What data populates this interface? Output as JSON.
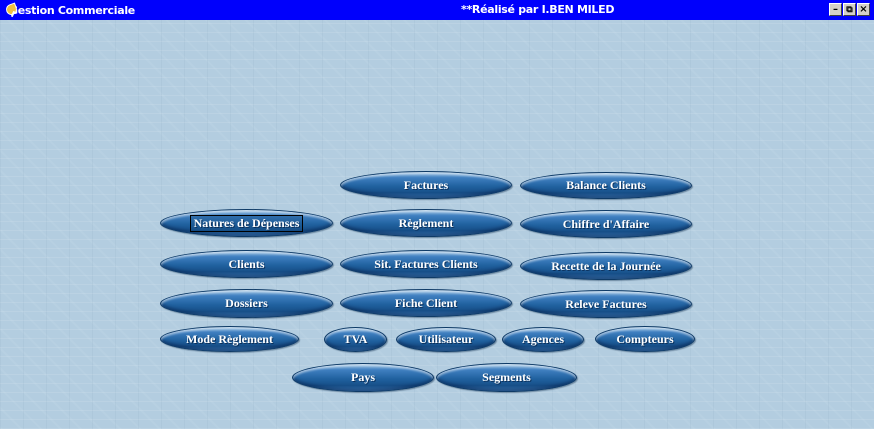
{
  "window": {
    "app_title": "Gestion Commerciale",
    "center_title": "**Réalisé par I.BEN MILED",
    "app_icon": "app-leaf-icon",
    "controls": {
      "minimize": "-",
      "restore": "×̅",
      "close": "×"
    },
    "colors": {
      "titlebar": "#0000fc",
      "background": "#b4cddf",
      "button": "#20619f"
    }
  },
  "buttons": {
    "factures": "Factures",
    "balance_clients": "Balance Clients",
    "natures_depenses": "Natures de Dépenses",
    "reglement": "Règlement",
    "chiffre_affaire": "Chiffre d'Affaire",
    "clients": "Clients",
    "sit_factures_clients": "Sit. Factures Clients",
    "recette_journee": "Recette de la Journée",
    "dossiers": "Dossiers",
    "fiche_client": "Fiche Client",
    "releve_factures": "Releve Factures",
    "mode_reglement": "Mode Règlement",
    "tva": "TVA",
    "utilisateur": "Utilisateur",
    "agences": "Agences",
    "compteurs": "Compteurs",
    "pays": "Pays",
    "segments": "Segments"
  }
}
